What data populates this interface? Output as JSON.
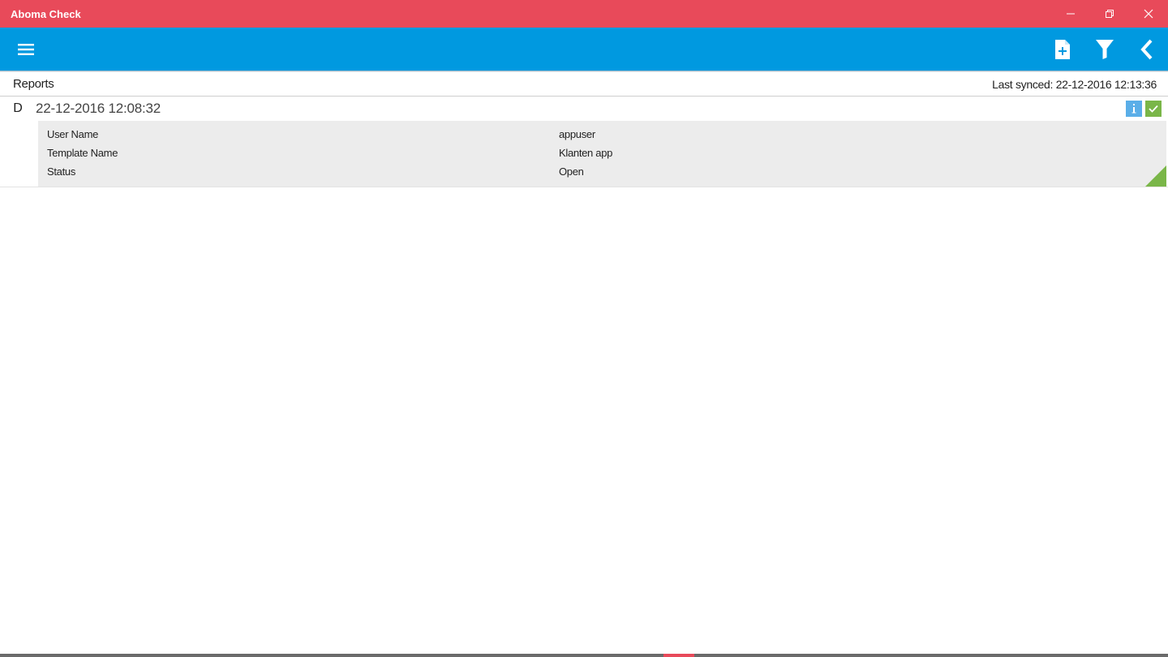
{
  "window": {
    "title": "Aboma Check",
    "title_bar_color": "#e84a5a"
  },
  "appbar": {
    "color": "#0099e0",
    "icons": [
      "hamburger-menu-icon",
      "new-document-icon",
      "filter-icon",
      "back-arrow-icon"
    ]
  },
  "reports": {
    "title": "Reports",
    "last_synced": "Last synced: 22-12-2016 12:13:36",
    "items": [
      {
        "letter": "D",
        "date": "22-12-2016 12:08:32",
        "details": [
          {
            "label": "User Name",
            "value": "appuser"
          },
          {
            "label": "Template Name",
            "value": "Klanten app"
          },
          {
            "label": "Status",
            "value": "Open"
          }
        ]
      }
    ]
  }
}
